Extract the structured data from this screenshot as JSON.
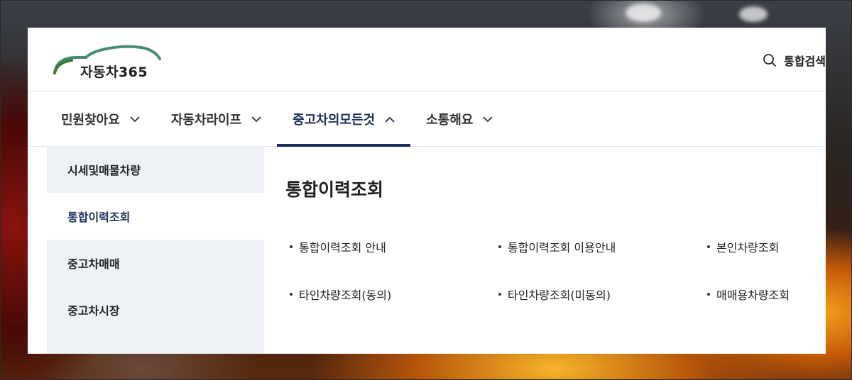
{
  "logo": {
    "text": "자동차365"
  },
  "header": {
    "search_label": "통합검색"
  },
  "gnb": [
    {
      "label": "민원찾아요",
      "icon": "chevron-down-icon"
    },
    {
      "label": "자동차라이프",
      "icon": "chevron-down-icon"
    },
    {
      "label": "중고차의모든것",
      "icon": "chevron-up-icon",
      "active": true
    },
    {
      "label": "소통해요",
      "icon": "chevron-down-icon"
    }
  ],
  "lnb": [
    {
      "label": "시세및매물차량"
    },
    {
      "label": "통합이력조회",
      "active": true
    },
    {
      "label": "중고차매매"
    },
    {
      "label": "중고차시장"
    }
  ],
  "main": {
    "title": "통합이력조회",
    "links": [
      {
        "label": "통합이력조회 안내"
      },
      {
        "label": "통합이력조회 이용안내"
      },
      {
        "label": "본인차량조회"
      },
      {
        "label": "타인차량조회(동의)"
      },
      {
        "label": "타인차량조회(미동의)"
      },
      {
        "label": "매매용차량조회"
      }
    ]
  },
  "colors": {
    "accent": "#1c2f5e",
    "logo_car": "#4a8a7a",
    "sidebar_bg": "#eef1f6"
  }
}
